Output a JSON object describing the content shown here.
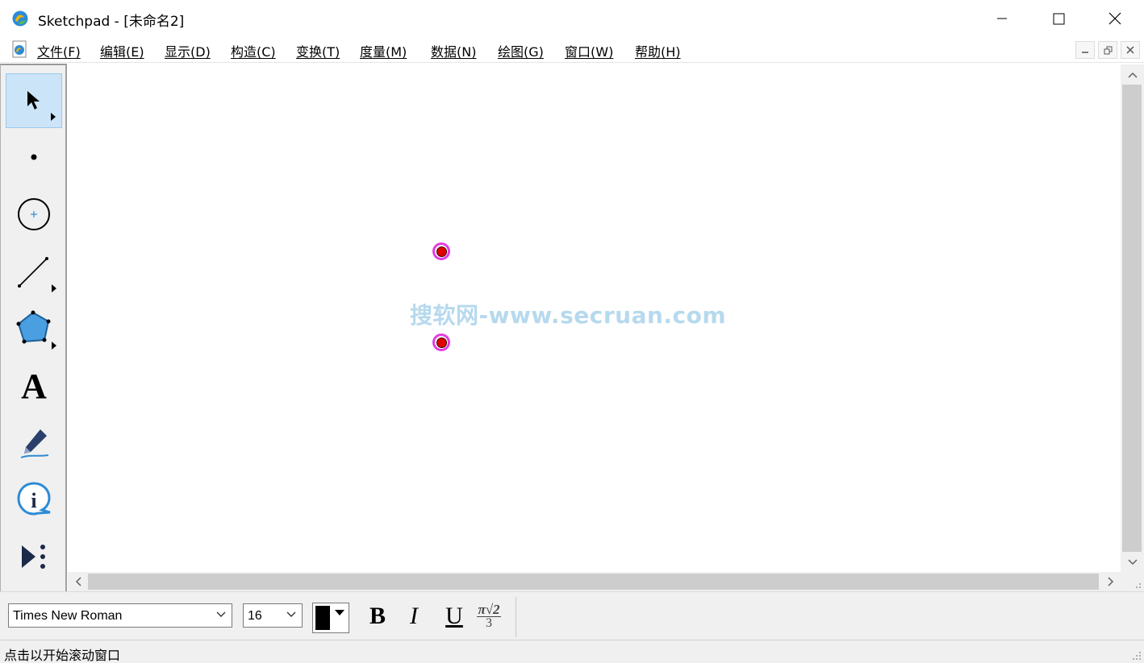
{
  "window": {
    "title": "Sketchpad  - [未命名2]",
    "controls": {
      "minimize": "minimize-icon",
      "maximize": "maximize-icon",
      "close": "close-icon"
    }
  },
  "menubar": {
    "items": [
      {
        "label": "文件(F)"
      },
      {
        "label": "编辑(E)"
      },
      {
        "label": "显示(D)"
      },
      {
        "label": "构造(C)"
      },
      {
        "label": "变换(T)"
      },
      {
        "label": "度量(M)"
      },
      {
        "label": "数据(N)"
      },
      {
        "label": "绘图(G)"
      },
      {
        "label": "窗口(W)"
      },
      {
        "label": "帮助(H)"
      }
    ],
    "mdi_controls": [
      "minimize-icon",
      "restore-icon",
      "close-icon"
    ]
  },
  "toolbox": {
    "tools": [
      {
        "name": "arrow-tool",
        "icon": "pointer-arrow-icon",
        "selected": true
      },
      {
        "name": "point-tool",
        "icon": "point-icon"
      },
      {
        "name": "compass-tool",
        "icon": "circle-icon"
      },
      {
        "name": "straightedge-tool",
        "icon": "line-segment-icon"
      },
      {
        "name": "polygon-tool",
        "icon": "pentagon-icon"
      },
      {
        "name": "text-tool",
        "icon": "text-a-icon",
        "glyph": "A"
      },
      {
        "name": "marker-tool",
        "icon": "pen-icon"
      },
      {
        "name": "information-tool",
        "icon": "info-icon"
      },
      {
        "name": "custom-tool",
        "icon": "custom-tools-icon"
      }
    ]
  },
  "canvas": {
    "point_colors": {
      "fill": "#e00000",
      "highlight": "#e23de2"
    },
    "watermark": "搜软网-www.secruan.com"
  },
  "formatbar": {
    "font_family": "Times New Roman",
    "font_size": "16",
    "color": "#000000",
    "bold_label": "B",
    "italic_label": "I",
    "underline_label": "U",
    "math_format": {
      "top": "π√2",
      "bottom": "3"
    }
  },
  "statusbar": {
    "text": "点击以开始滚动窗口"
  }
}
